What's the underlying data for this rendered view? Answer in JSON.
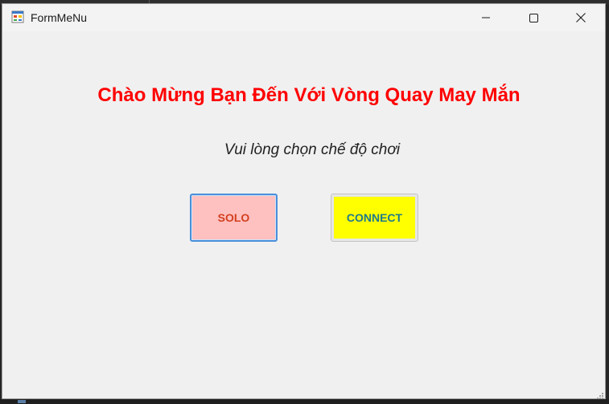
{
  "window": {
    "title": "FormMeNu",
    "icon": "winforms-app-icon",
    "controls": {
      "minimize": "minimize-icon",
      "maximize": "maximize-icon",
      "close": "close-icon"
    }
  },
  "main": {
    "welcome_text": "Chào Mừng Bạn Đến Với Vòng Quay May Mắn",
    "subtitle_text": "Vui lòng chọn chế độ chơi",
    "buttons": {
      "solo_label": "SOLO",
      "connect_label": "CONNECT"
    }
  },
  "colors": {
    "welcome_text": "#ff0000",
    "solo_background": "#ffc0c0",
    "solo_text": "#d2401e",
    "connect_background": "#ffff00",
    "connect_text": "#1f7a8c",
    "focus_border": "#4a8fdb",
    "form_background": "#f0f0f0"
  }
}
